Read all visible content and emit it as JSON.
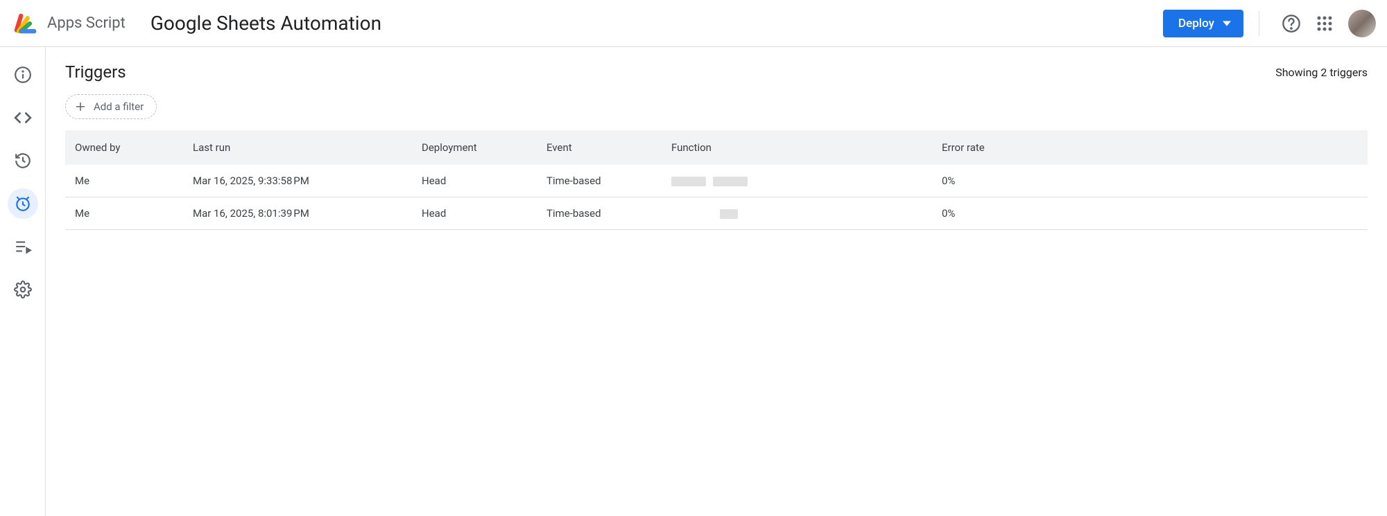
{
  "header": {
    "app_name": "Apps Script",
    "project_title": "Google Sheets Automation",
    "deploy_label": "Deploy"
  },
  "page": {
    "title": "Triggers",
    "count_text": "Showing 2 triggers",
    "filter_label": "Add a filter"
  },
  "columns": {
    "owned_by": "Owned by",
    "last_run": "Last run",
    "deployment": "Deployment",
    "event": "Event",
    "function": "Function",
    "error_rate": "Error rate"
  },
  "rows": [
    {
      "owned_by": "Me",
      "last_run": "Mar 16, 2025, 9:33:58 PM",
      "deployment": "Head",
      "event": "Time-based",
      "function": "",
      "error_rate": "0%"
    },
    {
      "owned_by": "Me",
      "last_run": "Mar 16, 2025, 8:01:39 PM",
      "deployment": "Head",
      "event": "Time-based",
      "function": "",
      "error_rate": "0%"
    }
  ]
}
